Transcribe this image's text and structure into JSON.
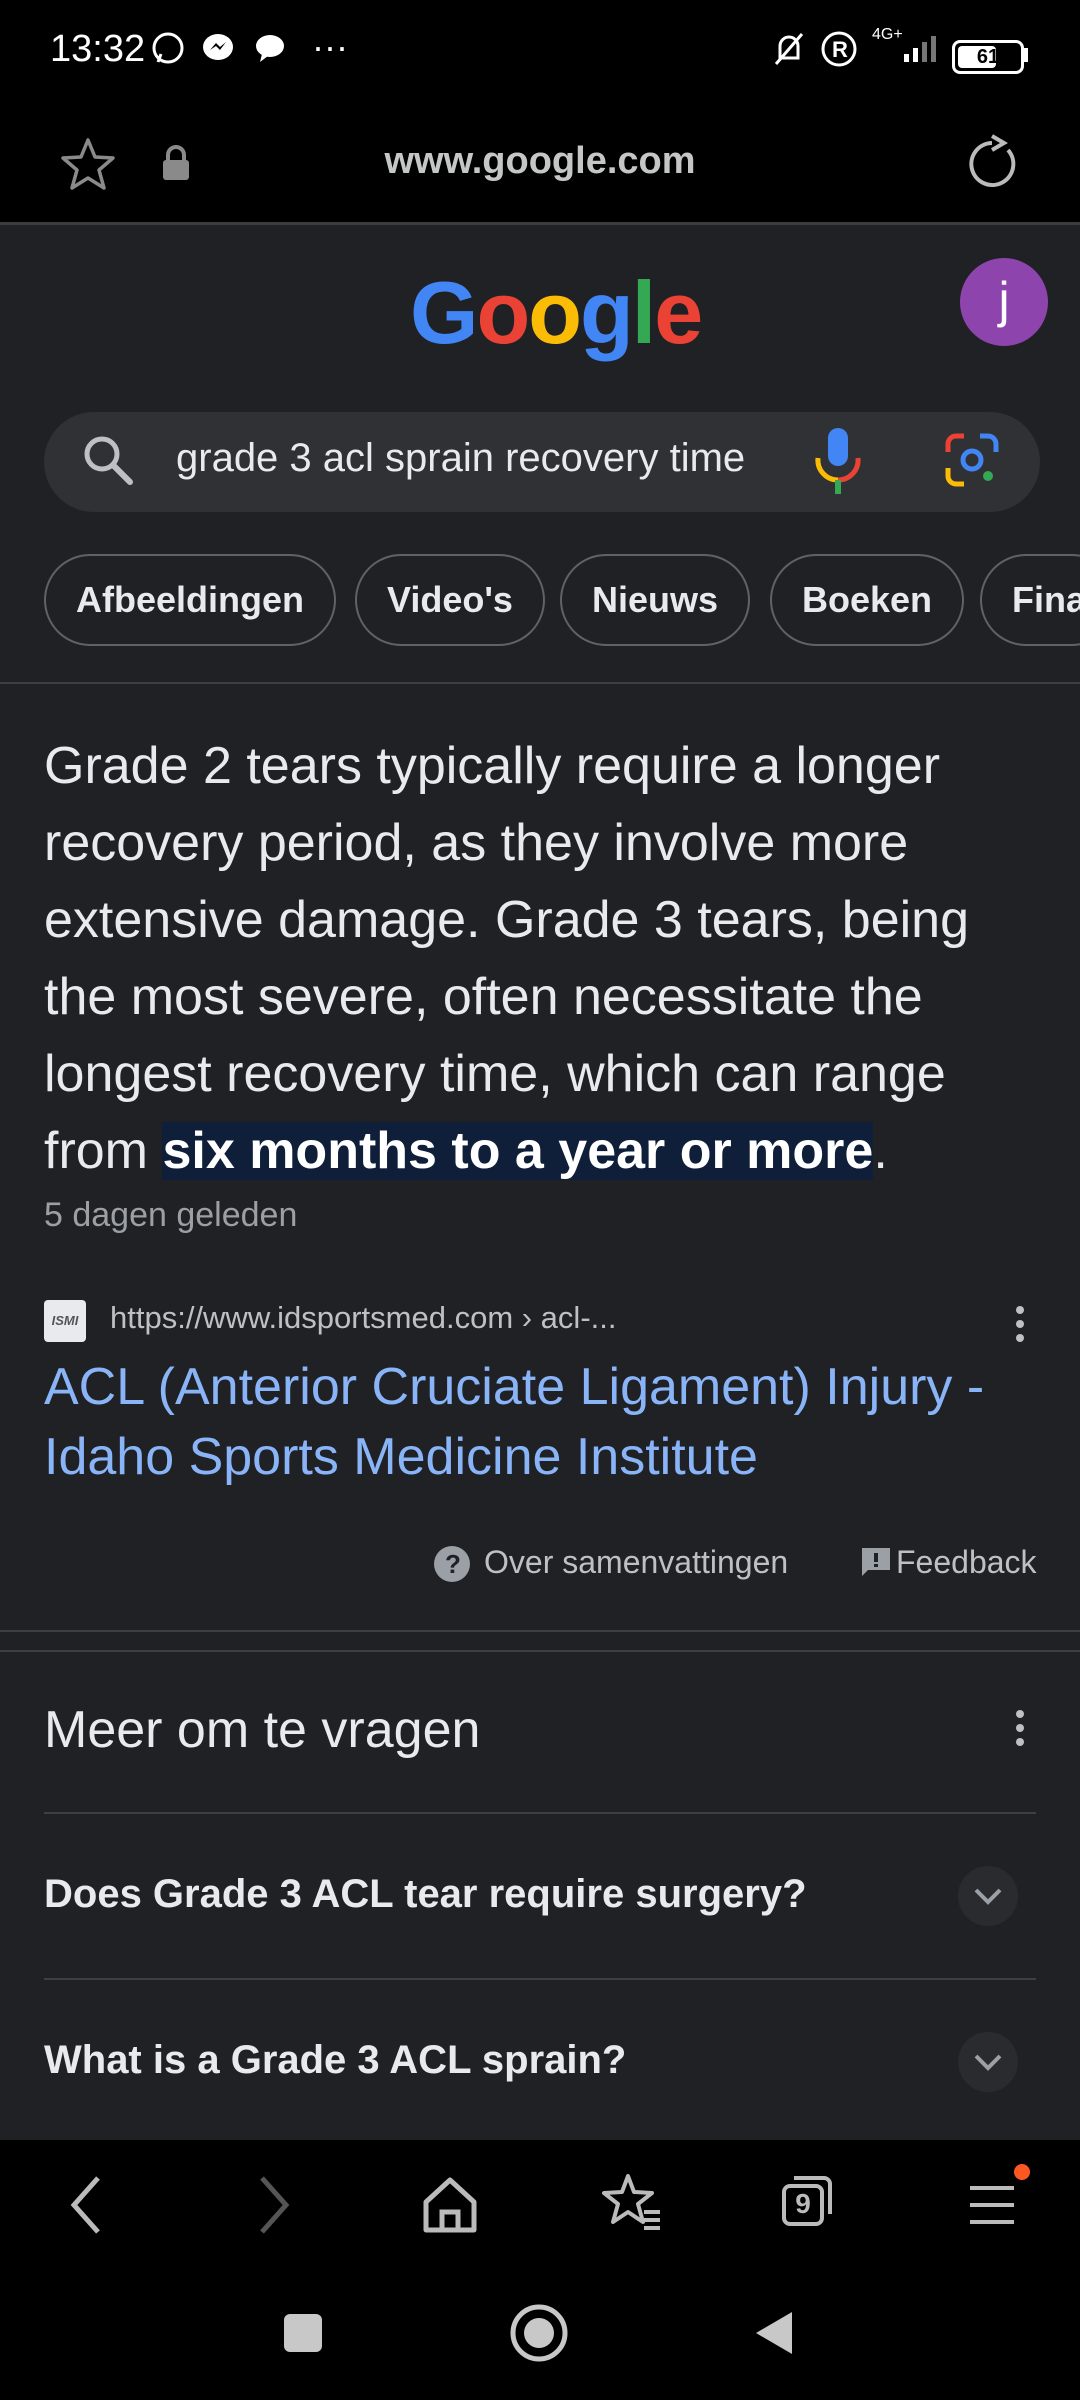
{
  "status_bar": {
    "time": "13:32",
    "network": "4G+",
    "battery": "61",
    "more": "···",
    "icons": [
      "whatsapp-icon",
      "messenger-icon",
      "chat-icon",
      "mute-icon",
      "registered-icon",
      "signal-icon",
      "battery-icon"
    ]
  },
  "url_bar": {
    "url": "www.google.com"
  },
  "header": {
    "logo": [
      "G",
      "o",
      "o",
      "g",
      "l",
      "e"
    ],
    "logo_colors": [
      "#4285f4",
      "#ea4335",
      "#fbbc05",
      "#4285f4",
      "#34a853",
      "#ea4335"
    ],
    "avatar_letter": "j"
  },
  "search": {
    "query": "grade 3 acl sprain recovery time"
  },
  "chips": [
    "Afbeeldingen",
    "Video's",
    "Nieuws",
    "Boeken",
    "Fina"
  ],
  "snippet": {
    "text_before": "Grade 2 tears typically require a longer recovery period, as they involve more extensive damage. Grade 3 tears, being the most severe, often necessitate the longest recovery time, which can range from ",
    "highlight": "six months to a year or more",
    "text_after": ".",
    "date": "5 dagen geleden"
  },
  "source": {
    "favicon_text": "ISMI",
    "url": "https://www.idsportsmed.com › acl-...",
    "title": "ACL (Anterior Cruciate Ligament) Injury - Idaho Sports Medicine Institute"
  },
  "snippet_footer": {
    "about": "Over samenvattingen",
    "feedback": "Feedback"
  },
  "people_also_ask": {
    "title": "Meer om te vragen",
    "questions": [
      "Does Grade 3 ACL tear require surgery?",
      "What is a Grade 3 ACL sprain?"
    ]
  },
  "browser_nav": {
    "tabs_count": "9"
  },
  "colors": {
    "background": "#202124",
    "link": "#8ab4f8",
    "highlight": "#0f1f3a",
    "notification_dot": "#ff5722"
  }
}
